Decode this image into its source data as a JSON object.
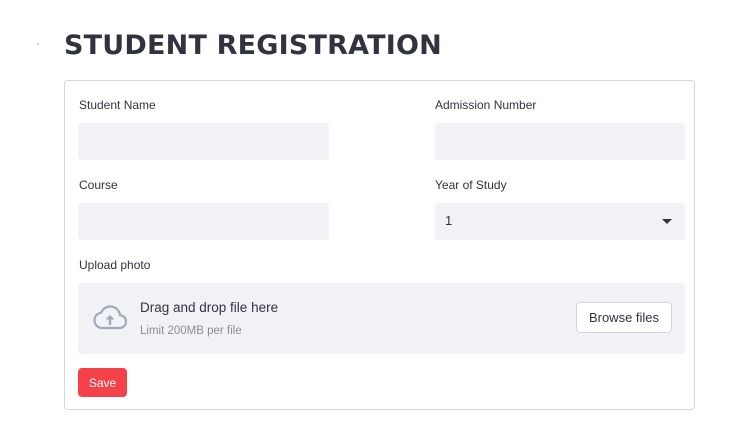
{
  "page": {
    "title": "STUDENT REGISTRATION"
  },
  "form": {
    "student_name": {
      "label": "Student Name",
      "value": ""
    },
    "admission_number": {
      "label": "Admission Number",
      "value": ""
    },
    "course": {
      "label": "Course",
      "value": ""
    },
    "year_of_study": {
      "label": "Year of Study",
      "selected": "1"
    },
    "upload": {
      "label": "Upload photo",
      "drop_text": "Drag and drop file here",
      "limit_text": "Limit 200MB per file",
      "browse_label": "Browse files",
      "icon": "cloud-upload-icon"
    },
    "save_label": "Save"
  },
  "colors": {
    "accent": "#f5424a",
    "input_bg": "#f0f2f6",
    "text": "#31333f",
    "muted_text": "#8a8d96",
    "border": "#d6d6d9",
    "icon": "#a3a8b8"
  }
}
